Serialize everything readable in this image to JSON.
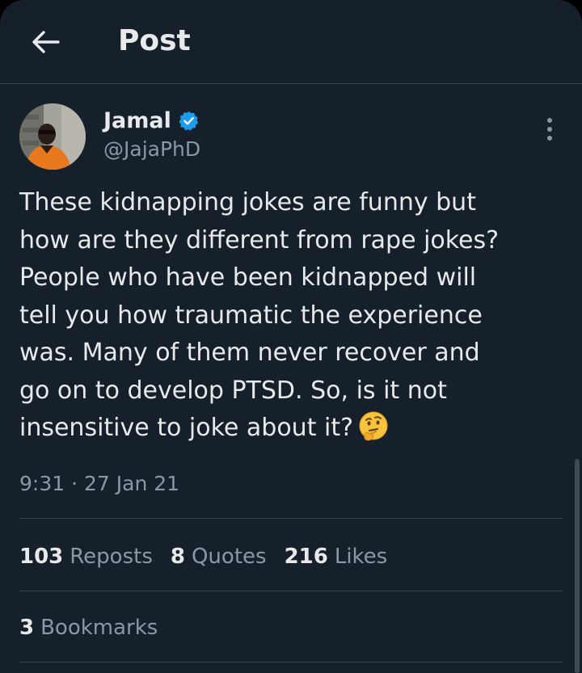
{
  "header": {
    "title": "Post",
    "back_icon": "arrow-left-icon"
  },
  "author": {
    "name": "Jamal",
    "handle": "@JajaPhD",
    "verified": true,
    "verified_icon": "verified-badge-icon"
  },
  "tweet": {
    "text": "These kidnapping jokes are funny but\nhow are they different from rape jokes?\nPeople who have been kidnapped will\ntell you how traumatic the experience\nwas. Many of them never recover and\ngo on to develop PTSD. So, is it not\ninsensitive to joke about it?",
    "emoji": "thinking-face-emoji",
    "time": "9:31",
    "separator": "·",
    "date": "27 Jan 21"
  },
  "stats": {
    "reposts_count": "103",
    "reposts_label": "Reposts",
    "quotes_count": "8",
    "quotes_label": "Quotes",
    "likes_count": "216",
    "likes_label": "Likes",
    "bookmarks_count": "3",
    "bookmarks_label": "Bookmarks"
  },
  "colors": {
    "background": "#15202b",
    "text": "#e7e9ea",
    "secondary_text": "#8b98a5",
    "divider": "#38444d",
    "verified": "#1d9bf0"
  }
}
